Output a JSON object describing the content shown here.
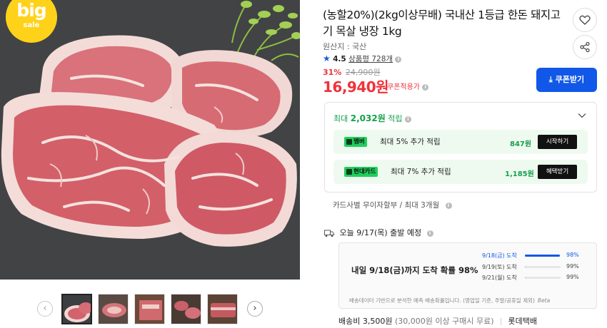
{
  "badge": {
    "big": "big",
    "sale": "sale"
  },
  "gallery": {
    "prev_arrow": "‹",
    "next_arrow": "›",
    "thumbnail_count": 5,
    "active_index": 0
  },
  "product": {
    "title": "(농할20%)(2kg이상무배) 국내산 1등급 한돈 돼지고기 목살 냉장 1kg",
    "origin_label": "원산지 : 국산",
    "rating_value": "4.5",
    "review_link": "상품평 728개",
    "discount_percent": "31%",
    "original_price": "24,900원",
    "sale_price": "16,940원",
    "coupon_applied": "쿠폰적용가",
    "coupon_button": "쿠폰받기"
  },
  "actions": {
    "wishlist_icon": "heart-icon",
    "share_icon": "share-icon"
  },
  "rewards": {
    "header_prefix": "최대",
    "header_amount": "2,032원",
    "header_suffix": "적립",
    "rows": [
      {
        "badge": "멤버",
        "text": "최대 5% 추가 적립",
        "value": "847원",
        "button": "시작하기"
      },
      {
        "badge": "현대카드",
        "text": "최대 7% 추가 적립",
        "value": "1,185원",
        "button": "혜택받기"
      }
    ]
  },
  "installment": "카드사별 무이자할부 / 최대 3개월",
  "shipping": {
    "departure": "오늘 9/17(목) 출발 예정",
    "arrival_headline": "내일 9/18(금)까지 도착 확률 98%",
    "forecast": [
      {
        "label": "9/18(금) 도착",
        "percent": "98%",
        "ratio": 0.98
      },
      {
        "label": "9/19(토) 도착",
        "percent": "99%",
        "ratio": 0.01
      },
      {
        "label": "9/21(월) 도착",
        "percent": "99%",
        "ratio": 0.01
      }
    ],
    "note": "배송데이터 기반으로 분석한 예측 배송확률입니다. (영업일 기준, 주말/공휴일 제외)",
    "beta": "Beta",
    "fee": "배송비 3,500원",
    "fee_condition": "(30,000원 이상 구매시 무료)",
    "carrier": "롯데택배"
  },
  "colors": {
    "accent": "#1158e8",
    "price": "#f0323a",
    "reward": "#15a04c",
    "badge": "#ffd21a"
  }
}
